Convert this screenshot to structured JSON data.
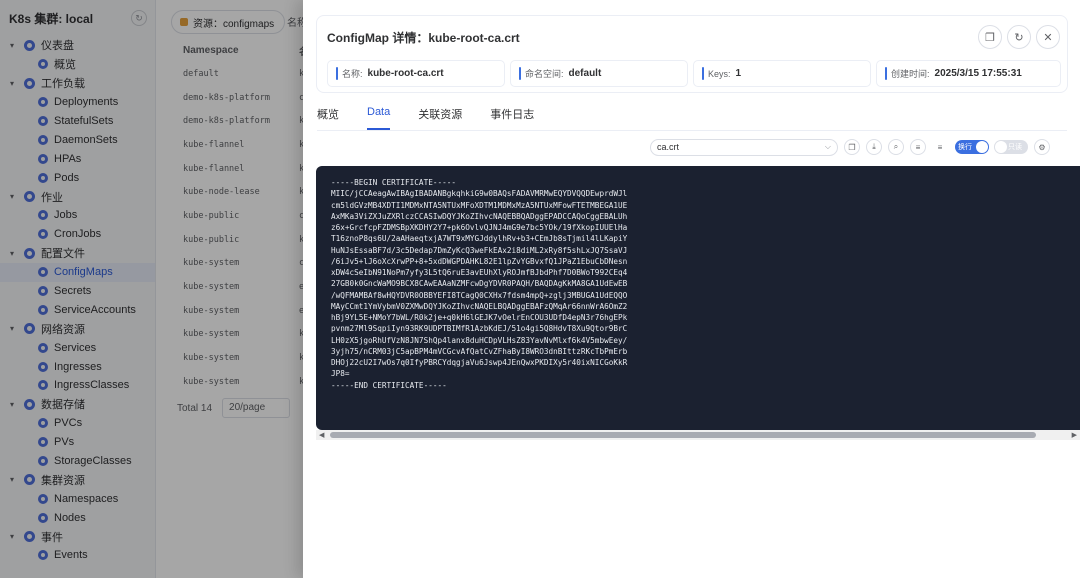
{
  "sidebar": {
    "title": "K8s 集群: local",
    "groups": [
      {
        "label": "仪表盘",
        "items": [
          "概览"
        ]
      },
      {
        "label": "工作负载",
        "items": [
          "Deployments",
          "StatefulSets",
          "DaemonSets",
          "HPAs",
          "Pods"
        ]
      },
      {
        "label": "作业",
        "items": [
          "Jobs",
          "CronJobs"
        ]
      },
      {
        "label": "配置文件",
        "items": [
          "ConfigMaps",
          "Secrets",
          "ServiceAccounts"
        ]
      },
      {
        "label": "网络资源",
        "items": [
          "Services",
          "Ingresses",
          "IngressClasses"
        ]
      },
      {
        "label": "数据存储",
        "items": [
          "PVCs",
          "PVs",
          "StorageClasses"
        ]
      },
      {
        "label": "集群资源",
        "items": [
          "Namespaces",
          "Nodes"
        ]
      },
      {
        "label": "事件",
        "items": [
          "Events"
        ]
      }
    ],
    "active_item": "ConfigMaps"
  },
  "background": {
    "resource_tag": "资源：configmaps",
    "name_filter_label": "名称",
    "table": {
      "columns": [
        "Namespace",
        "名"
      ],
      "rows": [
        [
          "default",
          "k"
        ],
        [
          "demo-k8s-platform",
          "c"
        ],
        [
          "demo-k8s-platform",
          "k"
        ],
        [
          "kube-flannel",
          "k"
        ],
        [
          "kube-flannel",
          "k"
        ],
        [
          "kube-node-lease",
          "k"
        ],
        [
          "kube-public",
          "c"
        ],
        [
          "kube-public",
          "k"
        ],
        [
          "kube-system",
          "c"
        ],
        [
          "kube-system",
          "e"
        ],
        [
          "kube-system",
          "e"
        ],
        [
          "kube-system",
          "k"
        ],
        [
          "kube-system",
          "k"
        ],
        [
          "kube-system",
          "k"
        ]
      ]
    },
    "pagination": {
      "total": "Total 14",
      "page_size": "20/page"
    }
  },
  "drawer": {
    "title": "ConfigMap 详情：kube-root-ca.crt",
    "info": [
      {
        "label": "名称:",
        "value": "kube-root-ca.crt"
      },
      {
        "label": "命名空间:",
        "value": "default"
      },
      {
        "label": "Keys:",
        "value": "1"
      },
      {
        "label": "创建时间:",
        "value": "2025/3/15 17:55:31"
      }
    ],
    "tabs": [
      "概览",
      "Data",
      "关联资源",
      "事件日志"
    ],
    "active_tab": "Data",
    "key_select": "ca.crt",
    "wrap_toggle_label": "换行",
    "readonly_toggle_label": "只读",
    "code": "-----BEGIN CERTIFICATE-----\nMIIC/jCCAeagAwIBAgIBADANBgkqhkiG9w0BAQsFADAVMRMwEQYDVQQDEwprdWJl\ncm5ldGVzMB4XDTI1MDMxNTA5NTUxMFoXDTM1MDMxMzA5NTUxMFowFTETMBEGA1UE\nAxMKa3ViZXJuZXRlczCCASIwDQYJKoZIhvcNAQEBBQADggEPADCCAQoCggEBALUh\nz6x+GrcfcpFZDMSBpXKDHY2Y7+pk6OvlvQJNJ4mG9e7bc5YOk/19fXkopIUUElHa\nT16znoP8qs6U/2aAHaeqtxjA7WT9xMYGJddylhRv+b3+CEmJb8sTjmil4lLKapiY\nHuNJsEssaBF7d/3c5Dedap7DmZyKcQ3weFkEAx2i8diML2xRy8f5shLxJQ7SsaVJ\n/6iJv5+lJ6oXcXrwPP+8+5xdDWGPDAHKL82E1lpZvYGBvxfQ1JPaZ1EbuCbDNesn\nxDW4cSeIbN91NoPm7yfy3L5tQ6ruE3avEUhXlyROJmfBJbdPhf7D0BWoT992CEq4\n27GB0k0GncWaMO9BCX8CAwEAAaNZMFcwDgYDVR0PAQH/BAQDAgKkMA8GA1UdEwEB\n/wQFMAMBAf8wHQYDVR0OBBYEFI8TCagQ0CXHx7fdsm4mpQ+zglj3MBUGA1UdEQQO\nMAyCCmt1YmVybmV0ZXMwDQYJKoZIhvcNAQELBQADggEBAFzQMqAr66nnWrA6OmZ2\nhBj9YL5E+NMoY7bWL/R0k2je+q0kH6lGEJK7vOelrEnCOU3UDfD4epN3r76hgEPk\npvnm27Ml9SqpiIyn93RK9UDPTBIMfR1AzbKdEJ/51o4gi5Q8HdvT8Xu9Qtor9BrC\nLH0zX5jgoRhUfVzN8JN7ShQp4lanx8duHCDpVLHsZ83YavNvMlxf6k4V5mbwEey/\n3yjh75/nCRM03jC5apBPM4mVCGcvAfQatCvZFhaByI8WRO3dnBIttzRKcTbPmErb\nDHOj22cU2I7wOs7q0IfyPBRCYdqgjaVu6Jswp4JEnQwxPKDIXy5r40ixNICGoKkR\nJP8=\n-----END CERTIFICATE-----"
  }
}
